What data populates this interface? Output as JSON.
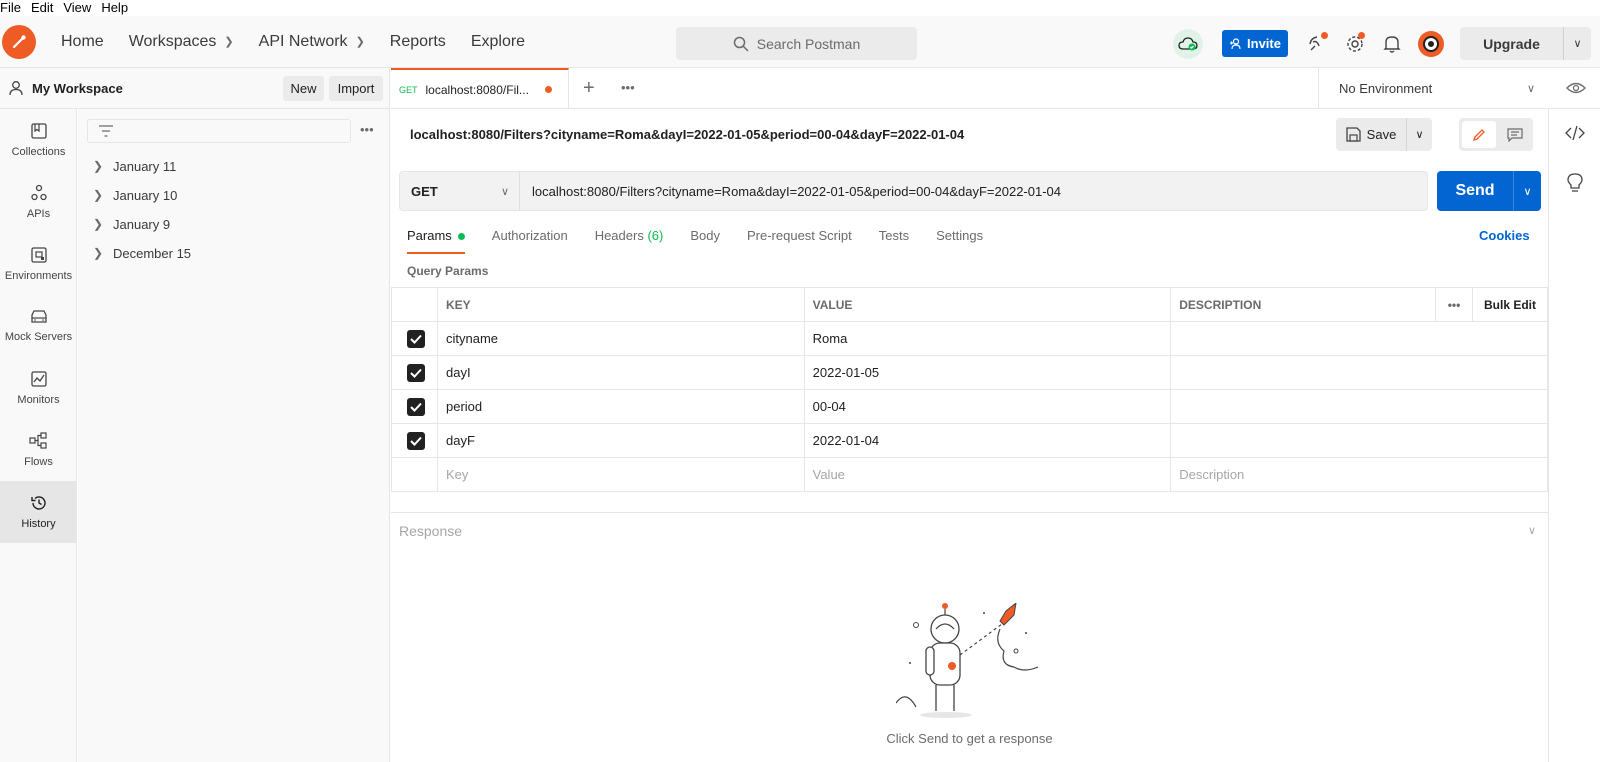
{
  "menu": [
    "File",
    "Edit",
    "View",
    "Help"
  ],
  "header": {
    "nav": [
      {
        "label": "Home",
        "dropdown": false
      },
      {
        "label": "Workspaces",
        "dropdown": true
      },
      {
        "label": "API Network",
        "dropdown": true
      },
      {
        "label": "Reports",
        "dropdown": false
      },
      {
        "label": "Explore",
        "dropdown": false
      }
    ],
    "search_placeholder": "Search Postman",
    "invite_label": "Invite",
    "upgrade_label": "Upgrade"
  },
  "workspace": {
    "name": "My Workspace",
    "new_label": "New",
    "import_label": "Import"
  },
  "leftnav": [
    {
      "label": "Collections",
      "icon": "collections-icon"
    },
    {
      "label": "APIs",
      "icon": "apis-icon"
    },
    {
      "label": "Environments",
      "icon": "environments-icon"
    },
    {
      "label": "Mock Servers",
      "icon": "mock-servers-icon"
    },
    {
      "label": "Monitors",
      "icon": "monitors-icon"
    },
    {
      "label": "Flows",
      "icon": "flows-icon"
    },
    {
      "label": "History",
      "icon": "history-icon",
      "active": true
    }
  ],
  "history": [
    "January 11",
    "January 10",
    "January 9",
    "December 15"
  ],
  "tab": {
    "method": "GET",
    "title": "localhost:8080/Fil..."
  },
  "environment": "No Environment",
  "request": {
    "title": "localhost:8080/Filters?cityname=Roma&dayI=2022-01-05&period=00-04&dayF=2022-01-04",
    "save_label": "Save",
    "method": "GET",
    "url": "localhost:8080/Filters?cityname=Roma&dayI=2022-01-05&period=00-04&dayF=2022-01-04",
    "send_label": "Send",
    "tabs": {
      "params": "Params",
      "authorization": "Authorization",
      "headers": "Headers",
      "headers_count": "(6)",
      "body": "Body",
      "prerequest": "Pre-request Script",
      "tests": "Tests",
      "settings": "Settings"
    },
    "cookies_label": "Cookies",
    "query_params_label": "Query Params",
    "table": {
      "headers": {
        "key": "KEY",
        "value": "VALUE",
        "description": "DESCRIPTION",
        "bulk": "Bulk Edit"
      },
      "rows": [
        {
          "key": "cityname",
          "value": "Roma",
          "description": "",
          "checked": true
        },
        {
          "key": "dayI",
          "value": "2022-01-05",
          "description": "",
          "checked": true
        },
        {
          "key": "period",
          "value": "00-04",
          "description": "",
          "checked": true
        },
        {
          "key": "dayF",
          "value": "2022-01-04",
          "description": "",
          "checked": true
        }
      ],
      "placeholders": {
        "key": "Key",
        "value": "Value",
        "description": "Description"
      }
    }
  },
  "response": {
    "title": "Response",
    "hint": "Click Send to get a response"
  },
  "colors": {
    "brand": "#ef5b25",
    "primary": "#0265d2",
    "success": "#0cbb52"
  }
}
